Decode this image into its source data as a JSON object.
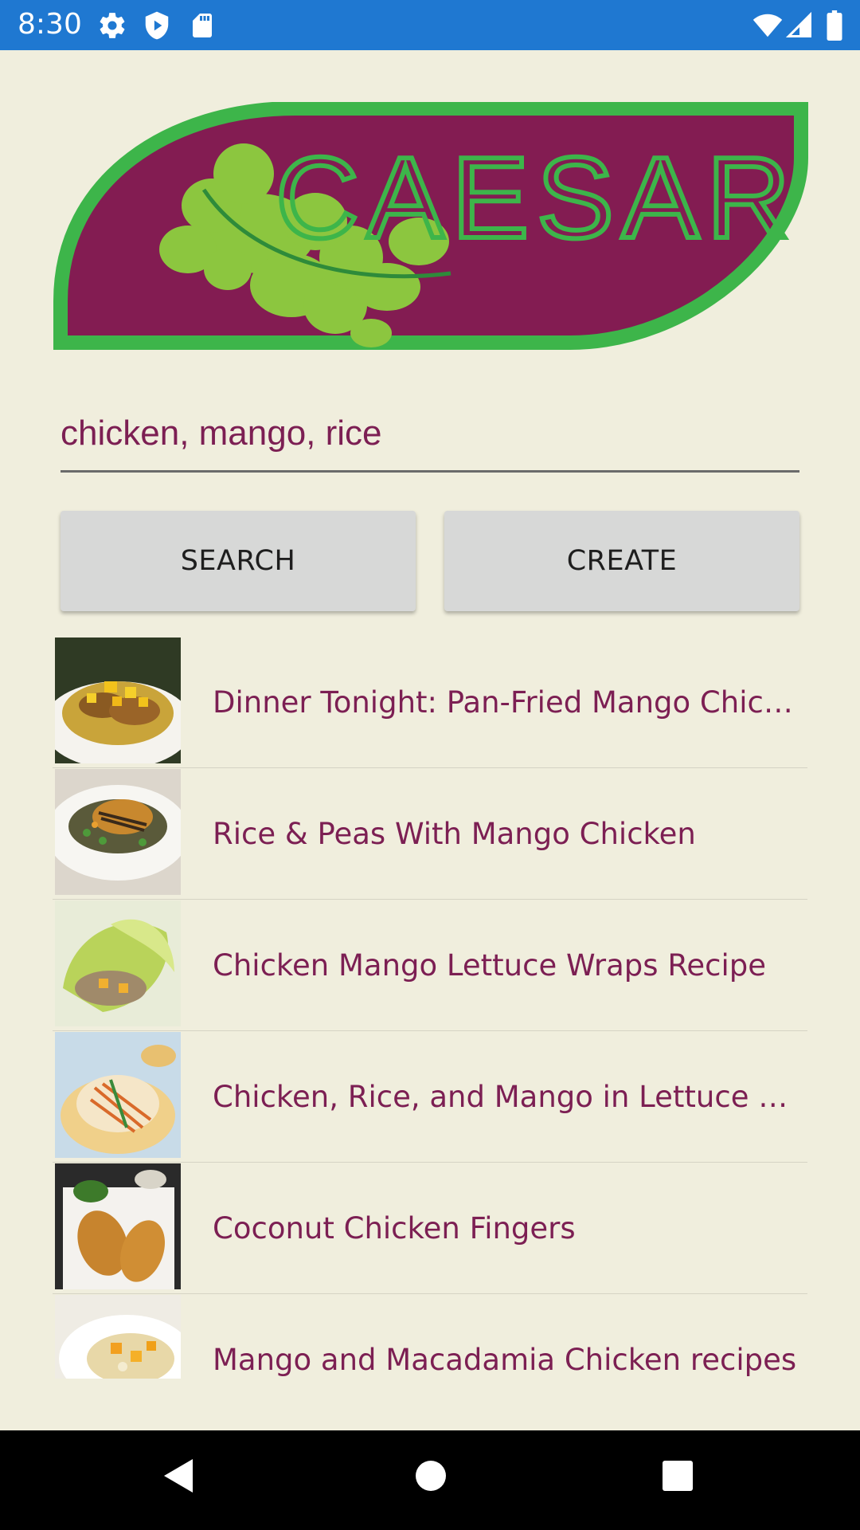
{
  "status_bar": {
    "time": "8:30",
    "left_icons": [
      "gear-icon",
      "shield-play-icon",
      "sd-card-icon"
    ],
    "right_icons": [
      "wifi-icon",
      "cellular-signal-icon",
      "battery-icon"
    ]
  },
  "logo": {
    "text": "CAESAR",
    "colors": {
      "background": "#831c52",
      "border": "#3db54a",
      "text": "#3db54a",
      "leaf": "#8cc63f"
    }
  },
  "search": {
    "value": "chicken, mango, rice"
  },
  "buttons": {
    "search_label": "SEARCH",
    "create_label": "CREATE"
  },
  "results": [
    {
      "title": "Dinner Tonight: Pan-Fried Mango Chicken R…",
      "thumb": "mango-chicken-plate-photo"
    },
    {
      "title": "Rice & Peas With Mango Chicken",
      "thumb": "grilled-chicken-rice-photo"
    },
    {
      "title": "Chicken Mango Lettuce Wraps Recipe",
      "thumb": "lettuce-wraps-photo"
    },
    {
      "title": "Chicken, Rice, and Mango in Lettuce Wraps",
      "thumb": "rice-noodle-wraps-photo"
    },
    {
      "title": "Coconut Chicken Fingers",
      "thumb": "chicken-fingers-photo"
    },
    {
      "title": "Mango and Macadamia Chicken recipes",
      "thumb": "mango-macadamia-photo"
    }
  ],
  "nav_bar": {
    "icons": [
      "back-icon",
      "home-icon",
      "recents-icon"
    ]
  },
  "colors": {
    "status_bar": "#1f78d1",
    "page_background": "#f0eedd",
    "accent_text": "#7c1f53",
    "button_bg": "#d7d8d7"
  }
}
